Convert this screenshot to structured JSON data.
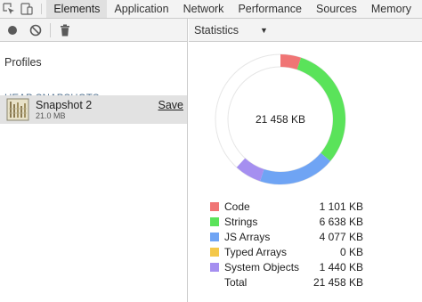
{
  "toolbar": {
    "tabs": [
      {
        "label": "Elements",
        "selected": true
      },
      {
        "label": "Application",
        "selected": false
      },
      {
        "label": "Network",
        "selected": false
      },
      {
        "label": "Performance",
        "selected": false
      },
      {
        "label": "Sources",
        "selected": false
      },
      {
        "label": "Memory",
        "selected": false
      }
    ]
  },
  "sidebar": {
    "profiles_title": "Profiles",
    "section_title": "HEAP SNAPSHOTS",
    "snapshot": {
      "name": "Snapshot 2",
      "size": "21.0 MB",
      "save_label": "Save"
    }
  },
  "view": {
    "selected": "Statistics",
    "caret": "▼"
  },
  "chart_data": {
    "type": "pie",
    "center_label": "21 458 KB",
    "unit": "KB",
    "slices": [
      {
        "name": "Code",
        "value": 1101,
        "value_label": "1 101 KB",
        "color": "#f07575"
      },
      {
        "name": "Strings",
        "value": 6638,
        "value_label": "6 638 KB",
        "color": "#5ae35a"
      },
      {
        "name": "JS Arrays",
        "value": 4077,
        "value_label": "4 077 KB",
        "color": "#6fa4f4"
      },
      {
        "name": "Typed Arrays",
        "value": 0,
        "value_label": "0 KB",
        "color": "#f4c84a"
      },
      {
        "name": "System Objects",
        "value": 1440,
        "value_label": "1 440 KB",
        "color": "#a58ff0"
      }
    ],
    "total": {
      "name": "Total",
      "value": 21458,
      "value_label": "21 458 KB"
    },
    "remainder_color": "#ffffff"
  }
}
